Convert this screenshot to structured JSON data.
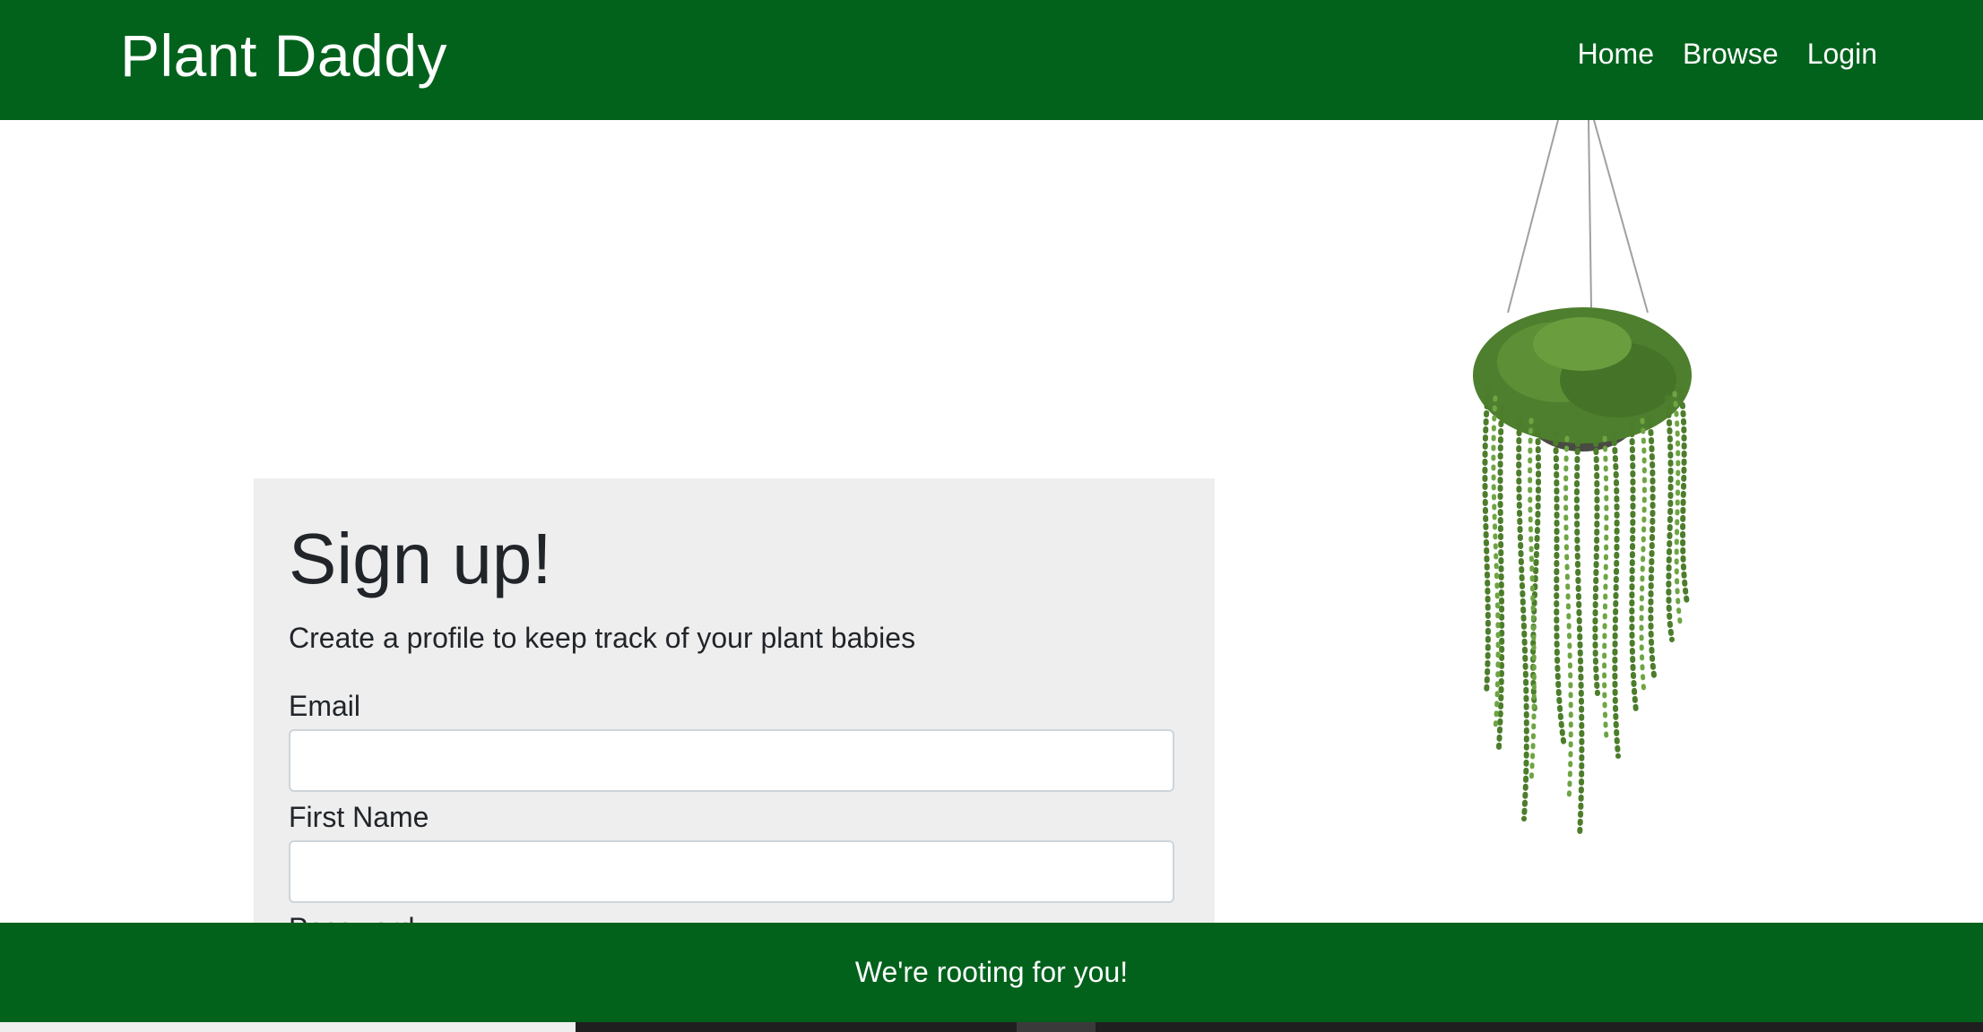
{
  "navbar": {
    "brand": "Plant Daddy",
    "links": [
      {
        "label": "Home"
      },
      {
        "label": "Browse"
      },
      {
        "label": "Login"
      }
    ]
  },
  "signup": {
    "title": "Sign up!",
    "subtitle": "Create a profile to keep track of your plant babies",
    "fields": [
      {
        "label": "Email",
        "value": "",
        "placeholder": ""
      },
      {
        "label": "First Name",
        "value": "",
        "placeholder": ""
      },
      {
        "label": "Password",
        "value": "",
        "placeholder": ""
      }
    ]
  },
  "footer": {
    "text": "We're rooting for you!"
  },
  "colors": {
    "brand_green": "#02621c",
    "card_background": "#eeeeee",
    "input_border": "#ced4da"
  },
  "icons": {
    "plant_image": "hanging-plant-icon"
  }
}
